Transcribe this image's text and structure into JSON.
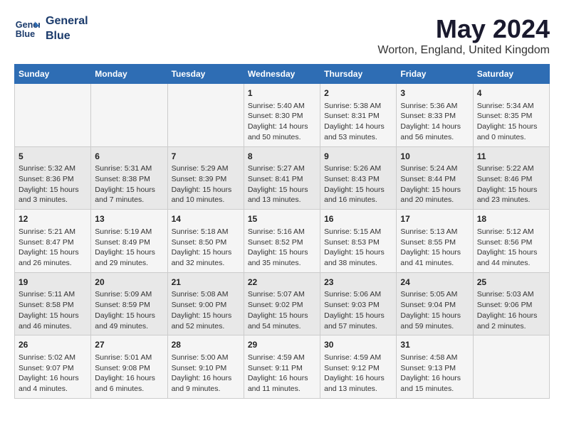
{
  "header": {
    "logo_line1": "General",
    "logo_line2": "Blue",
    "title": "May 2024",
    "subtitle": "Worton, England, United Kingdom"
  },
  "days_of_week": [
    "Sunday",
    "Monday",
    "Tuesday",
    "Wednesday",
    "Thursday",
    "Friday",
    "Saturday"
  ],
  "weeks": [
    {
      "cells": [
        {
          "day": "",
          "content": ""
        },
        {
          "day": "",
          "content": ""
        },
        {
          "day": "",
          "content": ""
        },
        {
          "day": "1",
          "content": "Sunrise: 5:40 AM\nSunset: 8:30 PM\nDaylight: 14 hours\nand 50 minutes."
        },
        {
          "day": "2",
          "content": "Sunrise: 5:38 AM\nSunset: 8:31 PM\nDaylight: 14 hours\nand 53 minutes."
        },
        {
          "day": "3",
          "content": "Sunrise: 5:36 AM\nSunset: 8:33 PM\nDaylight: 14 hours\nand 56 minutes."
        },
        {
          "day": "4",
          "content": "Sunrise: 5:34 AM\nSunset: 8:35 PM\nDaylight: 15 hours\nand 0 minutes."
        }
      ]
    },
    {
      "cells": [
        {
          "day": "5",
          "content": "Sunrise: 5:32 AM\nSunset: 8:36 PM\nDaylight: 15 hours\nand 3 minutes."
        },
        {
          "day": "6",
          "content": "Sunrise: 5:31 AM\nSunset: 8:38 PM\nDaylight: 15 hours\nand 7 minutes."
        },
        {
          "day": "7",
          "content": "Sunrise: 5:29 AM\nSunset: 8:39 PM\nDaylight: 15 hours\nand 10 minutes."
        },
        {
          "day": "8",
          "content": "Sunrise: 5:27 AM\nSunset: 8:41 PM\nDaylight: 15 hours\nand 13 minutes."
        },
        {
          "day": "9",
          "content": "Sunrise: 5:26 AM\nSunset: 8:43 PM\nDaylight: 15 hours\nand 16 minutes."
        },
        {
          "day": "10",
          "content": "Sunrise: 5:24 AM\nSunset: 8:44 PM\nDaylight: 15 hours\nand 20 minutes."
        },
        {
          "day": "11",
          "content": "Sunrise: 5:22 AM\nSunset: 8:46 PM\nDaylight: 15 hours\nand 23 minutes."
        }
      ]
    },
    {
      "cells": [
        {
          "day": "12",
          "content": "Sunrise: 5:21 AM\nSunset: 8:47 PM\nDaylight: 15 hours\nand 26 minutes."
        },
        {
          "day": "13",
          "content": "Sunrise: 5:19 AM\nSunset: 8:49 PM\nDaylight: 15 hours\nand 29 minutes."
        },
        {
          "day": "14",
          "content": "Sunrise: 5:18 AM\nSunset: 8:50 PM\nDaylight: 15 hours\nand 32 minutes."
        },
        {
          "day": "15",
          "content": "Sunrise: 5:16 AM\nSunset: 8:52 PM\nDaylight: 15 hours\nand 35 minutes."
        },
        {
          "day": "16",
          "content": "Sunrise: 5:15 AM\nSunset: 8:53 PM\nDaylight: 15 hours\nand 38 minutes."
        },
        {
          "day": "17",
          "content": "Sunrise: 5:13 AM\nSunset: 8:55 PM\nDaylight: 15 hours\nand 41 minutes."
        },
        {
          "day": "18",
          "content": "Sunrise: 5:12 AM\nSunset: 8:56 PM\nDaylight: 15 hours\nand 44 minutes."
        }
      ]
    },
    {
      "cells": [
        {
          "day": "19",
          "content": "Sunrise: 5:11 AM\nSunset: 8:58 PM\nDaylight: 15 hours\nand 46 minutes."
        },
        {
          "day": "20",
          "content": "Sunrise: 5:09 AM\nSunset: 8:59 PM\nDaylight: 15 hours\nand 49 minutes."
        },
        {
          "day": "21",
          "content": "Sunrise: 5:08 AM\nSunset: 9:00 PM\nDaylight: 15 hours\nand 52 minutes."
        },
        {
          "day": "22",
          "content": "Sunrise: 5:07 AM\nSunset: 9:02 PM\nDaylight: 15 hours\nand 54 minutes."
        },
        {
          "day": "23",
          "content": "Sunrise: 5:06 AM\nSunset: 9:03 PM\nDaylight: 15 hours\nand 57 minutes."
        },
        {
          "day": "24",
          "content": "Sunrise: 5:05 AM\nSunset: 9:04 PM\nDaylight: 15 hours\nand 59 minutes."
        },
        {
          "day": "25",
          "content": "Sunrise: 5:03 AM\nSunset: 9:06 PM\nDaylight: 16 hours\nand 2 minutes."
        }
      ]
    },
    {
      "cells": [
        {
          "day": "26",
          "content": "Sunrise: 5:02 AM\nSunset: 9:07 PM\nDaylight: 16 hours\nand 4 minutes."
        },
        {
          "day": "27",
          "content": "Sunrise: 5:01 AM\nSunset: 9:08 PM\nDaylight: 16 hours\nand 6 minutes."
        },
        {
          "day": "28",
          "content": "Sunrise: 5:00 AM\nSunset: 9:10 PM\nDaylight: 16 hours\nand 9 minutes."
        },
        {
          "day": "29",
          "content": "Sunrise: 4:59 AM\nSunset: 9:11 PM\nDaylight: 16 hours\nand 11 minutes."
        },
        {
          "day": "30",
          "content": "Sunrise: 4:59 AM\nSunset: 9:12 PM\nDaylight: 16 hours\nand 13 minutes."
        },
        {
          "day": "31",
          "content": "Sunrise: 4:58 AM\nSunset: 9:13 PM\nDaylight: 16 hours\nand 15 minutes."
        },
        {
          "day": "",
          "content": ""
        }
      ]
    }
  ]
}
